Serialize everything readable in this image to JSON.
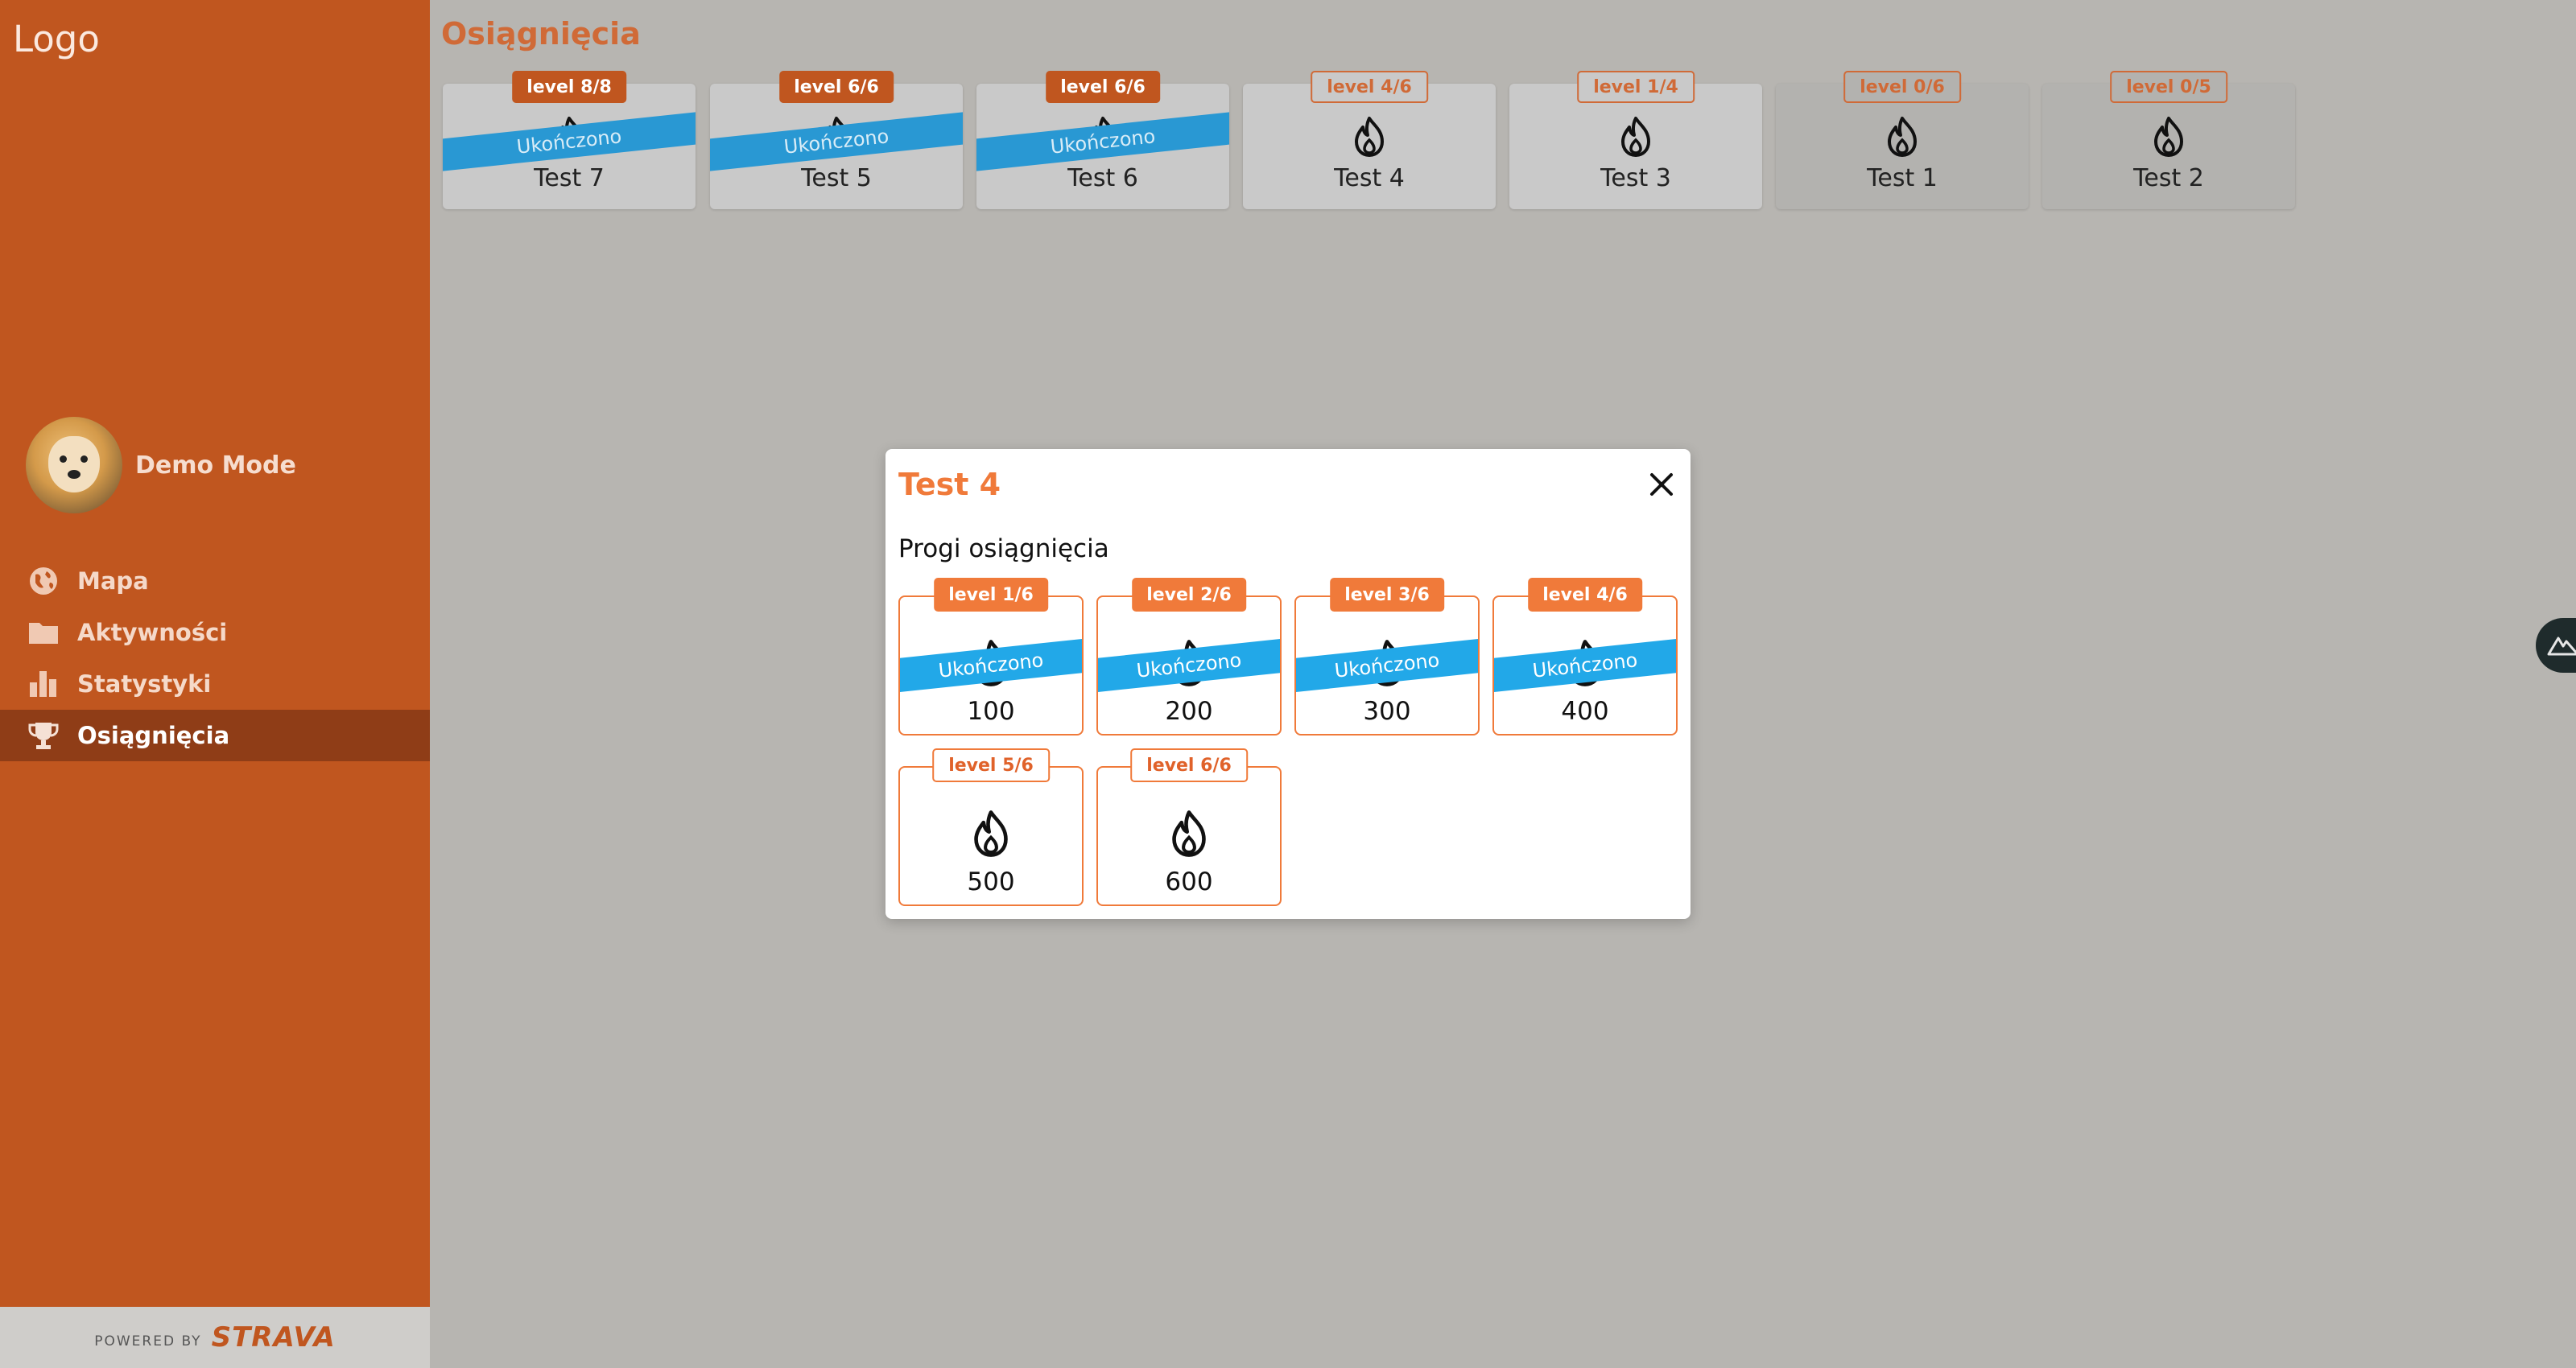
{
  "sidebar": {
    "logo": "Logo",
    "user_name": "Demo Mode",
    "nav": [
      {
        "label": "Mapa",
        "icon": "globe-icon"
      },
      {
        "label": "Aktywności",
        "icon": "folder-icon"
      },
      {
        "label": "Statystyki",
        "icon": "bar-chart-icon"
      },
      {
        "label": "Osiągnięcia",
        "icon": "trophy-icon",
        "active": true
      }
    ],
    "powered_by": "POWERED BY",
    "strava": "STRAVA"
  },
  "main": {
    "title": "Osiągnięcia",
    "cards": [
      {
        "name": "Test 7",
        "level": "level 8/8",
        "completed": true
      },
      {
        "name": "Test 5",
        "level": "level 6/6",
        "completed": true
      },
      {
        "name": "Test 6",
        "level": "level 6/6",
        "completed": true
      },
      {
        "name": "Test 4",
        "level": "level 4/6",
        "completed": false
      },
      {
        "name": "Test 3",
        "level": "level 1/4",
        "completed": false
      },
      {
        "name": "Test 1",
        "level": "level 0/6",
        "completed": false,
        "dim": true
      },
      {
        "name": "Test 2",
        "level": "level 0/5",
        "completed": false,
        "dim": true
      }
    ],
    "completed_label": "Ukończono"
  },
  "modal": {
    "title": "Test 4",
    "subtitle": "Progi osiągnięcia",
    "tiers": [
      {
        "level": "level 1/6",
        "value": "100",
        "completed": true
      },
      {
        "level": "level 2/6",
        "value": "200",
        "completed": true
      },
      {
        "level": "level 3/6",
        "value": "300",
        "completed": true
      },
      {
        "level": "level 4/6",
        "value": "400",
        "completed": true
      },
      {
        "level": "level 5/6",
        "value": "500",
        "completed": false
      },
      {
        "level": "level 6/6",
        "value": "600",
        "completed": false
      }
    ],
    "completed_label": "Ukończono"
  },
  "colors": {
    "sidebar": "#c0561f",
    "accent": "#f07a3a",
    "ribbon": "#22a8e8"
  }
}
